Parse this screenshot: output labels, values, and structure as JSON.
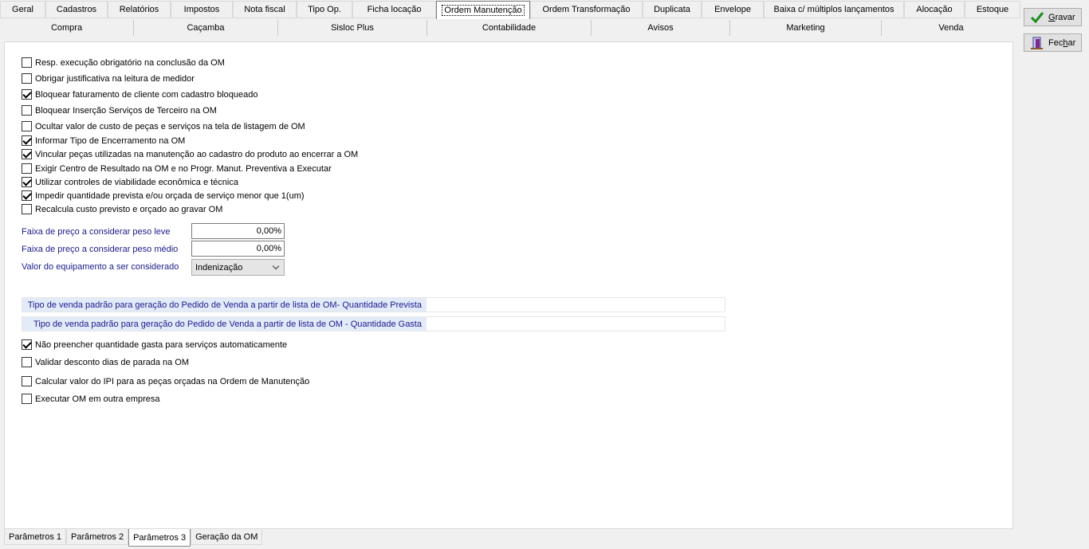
{
  "tabs_row1": [
    {
      "label": "Geral",
      "w": 57
    },
    {
      "label": "Cadastros",
      "w": 78
    },
    {
      "label": "Relatórios",
      "w": 79
    },
    {
      "label": "Impostos",
      "w": 78
    },
    {
      "label": "Nota fiscal",
      "w": 80
    },
    {
      "label": "Tipo Op.",
      "w": 70
    },
    {
      "label": "Ficha locação",
      "w": 105
    },
    {
      "label": "Ordem Manutenção",
      "w": 118,
      "active": true
    },
    {
      "label": "Ordem Transformação",
      "w": 141
    },
    {
      "label": "Duplicata",
      "w": 74
    },
    {
      "label": "Envelope",
      "w": 78
    },
    {
      "label": "Baixa c/ múltiplos lançamentos",
      "w": 176
    },
    {
      "label": "Alocação",
      "w": 76
    },
    {
      "label": "Estoque",
      "w": 70
    }
  ],
  "tabs_row2": [
    {
      "label": "Compra",
      "w": 168
    },
    {
      "label": "Caçamba",
      "w": 181
    },
    {
      "label": "Sisloc Plus",
      "w": 187
    },
    {
      "label": "Contabilidade",
      "w": 206
    },
    {
      "label": "Avisos",
      "w": 174
    },
    {
      "label": "Marketing",
      "w": 190
    },
    {
      "label": "Venda",
      "w": 174
    }
  ],
  "checkboxes_top": [
    {
      "label": "Resp. execução obrigatório na conclusão da OM",
      "checked": false
    },
    {
      "label": "Obrigar justificativa na leitura de medidor",
      "checked": false
    },
    {
      "label": "Bloquear faturamento de cliente com cadastro bloqueado",
      "checked": true
    },
    {
      "label": "Bloquear Inserção Serviços de Terceiro na OM",
      "checked": false
    },
    {
      "label": "Ocultar valor de custo de peças e serviços na tela de listagem de OM",
      "checked": false
    },
    {
      "label": "Informar Tipo de Encerramento na OM",
      "checked": true
    },
    {
      "label": "Vincular peças utilizadas na manutenção ao cadastro do produto ao encerrar a OM",
      "checked": true
    },
    {
      "label": "Exigir Centro de Resultado na OM e no Progr. Manut. Preventiva a Executar",
      "checked": false
    },
    {
      "label": "Utilizar controles de viabilidade econômica e técnica",
      "checked": true
    },
    {
      "label": "Impedir quantidade prevista e/ou orçada de serviço menor que 1(um)",
      "checked": true
    },
    {
      "label": "Recalcula custo previsto e orçado ao gravar OM",
      "checked": false
    }
  ],
  "fields": {
    "peso_leve_label": "Faixa de preço a considerar peso leve",
    "peso_leve_value": "0,00%",
    "peso_medio_label": "Faixa de preço a considerar peso médio",
    "peso_medio_value": "0,00%",
    "valor_equip_label": "Valor do equipamento a ser considerado",
    "valor_equip_value": "Indenização"
  },
  "tipo_venda": {
    "prevista_label": "Tipo de venda padrão para geração do Pedido de Venda a partir de lista de OM- Quantidade Prevista",
    "prevista_value": "",
    "gasta_label": "Tipo de venda padrão para geração do Pedido de Venda a partir de lista de OM - Quantidade Gasta",
    "gasta_value": ""
  },
  "checkboxes_bottom": [
    {
      "label": "Não preencher quantidade gasta para serviços automaticamente",
      "checked": true
    },
    {
      "label": "Validar desconto dias de parada na OM",
      "checked": false
    },
    {
      "label": "Calcular valor do IPI para as peças orçadas na Ordem de Manutenção",
      "checked": false
    },
    {
      "label": "Executar OM em outra empresa",
      "checked": false
    }
  ],
  "buttons": {
    "gravar": "Gravar",
    "gravar_accel": "G",
    "fechar_pre": "Fec",
    "fechar_accel": "h",
    "fechar_post": "ar"
  },
  "bottom_tabs": [
    {
      "label": "Parâmetros 1"
    },
    {
      "label": "Parâmetros 2"
    },
    {
      "label": "Parâmetros 3",
      "active": true
    },
    {
      "label": "Geração da OM"
    }
  ],
  "colors": {
    "label_blue": "#1a1a8c",
    "highlight_bg": "#e3ebf9",
    "check_green": "#1e8a1e",
    "door_purple": "#7a2a8a"
  }
}
